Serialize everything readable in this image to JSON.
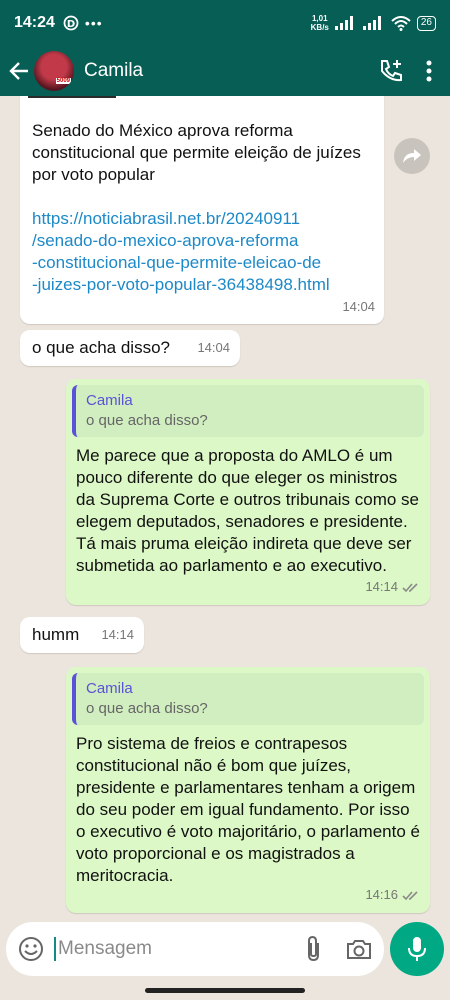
{
  "status_bar": {
    "time": "14:24",
    "net_speed_value": "1,01",
    "net_speed_unit": "KB/s",
    "battery": "26"
  },
  "header": {
    "contact_name": "Camila",
    "avatar_logo_text": "5009"
  },
  "messages": [
    {
      "direction": "in",
      "text": "Senado do México aprova reforma constitucional que permite eleição de juízes por voto popular",
      "link_lines": [
        "https://noticiabrasil.net.br/20240911",
        "/senado-do-mexico-aprova-reforma",
        "-constitucional-que-permite-eleicao-de",
        "-juizes-por-voto-popular-36438498.html"
      ],
      "time": "14:04"
    },
    {
      "direction": "in",
      "text": "o que acha disso?",
      "time": "14:04"
    },
    {
      "direction": "out",
      "quote_name": "Camila",
      "quote_text": "o que acha disso?",
      "text": "Me parece que a proposta do AMLO é um pouco diferente do que eleger os ministros da Suprema Corte e outros tribunais como se elegem deputados, senadores e presidente. Tá mais pruma eleição indireta que deve ser submetida ao parlamento e ao executivo.",
      "time": "14:14"
    },
    {
      "direction": "in",
      "text": "humm",
      "time": "14:14"
    },
    {
      "direction": "out",
      "quote_name": "Camila",
      "quote_text": "o que acha disso?",
      "text": "Pro sistema de freios e contrapesos constitucional não é bom que juízes, presidente e parlamentares tenham a origem do seu poder em igual fundamento. Por isso o executivo é voto majoritário, o parlamento é voto proporcional e os magistrados a meritocracia.",
      "time": "14:16"
    }
  ],
  "input": {
    "placeholder": "Mensagem"
  },
  "colors": {
    "header": "#065e54",
    "outgoing_bubble": "#dcf8c6",
    "incoming_bubble": "#ffffff",
    "link": "#1d89c7",
    "quote_name": "#5b51d8",
    "mic_button": "#00a884"
  },
  "icons": [
    "back-arrow-icon",
    "add-call-icon",
    "more-vert-icon",
    "forward-icon",
    "emoji-icon",
    "attach-icon",
    "camera-icon",
    "mic-icon",
    "double-check-icon"
  ]
}
